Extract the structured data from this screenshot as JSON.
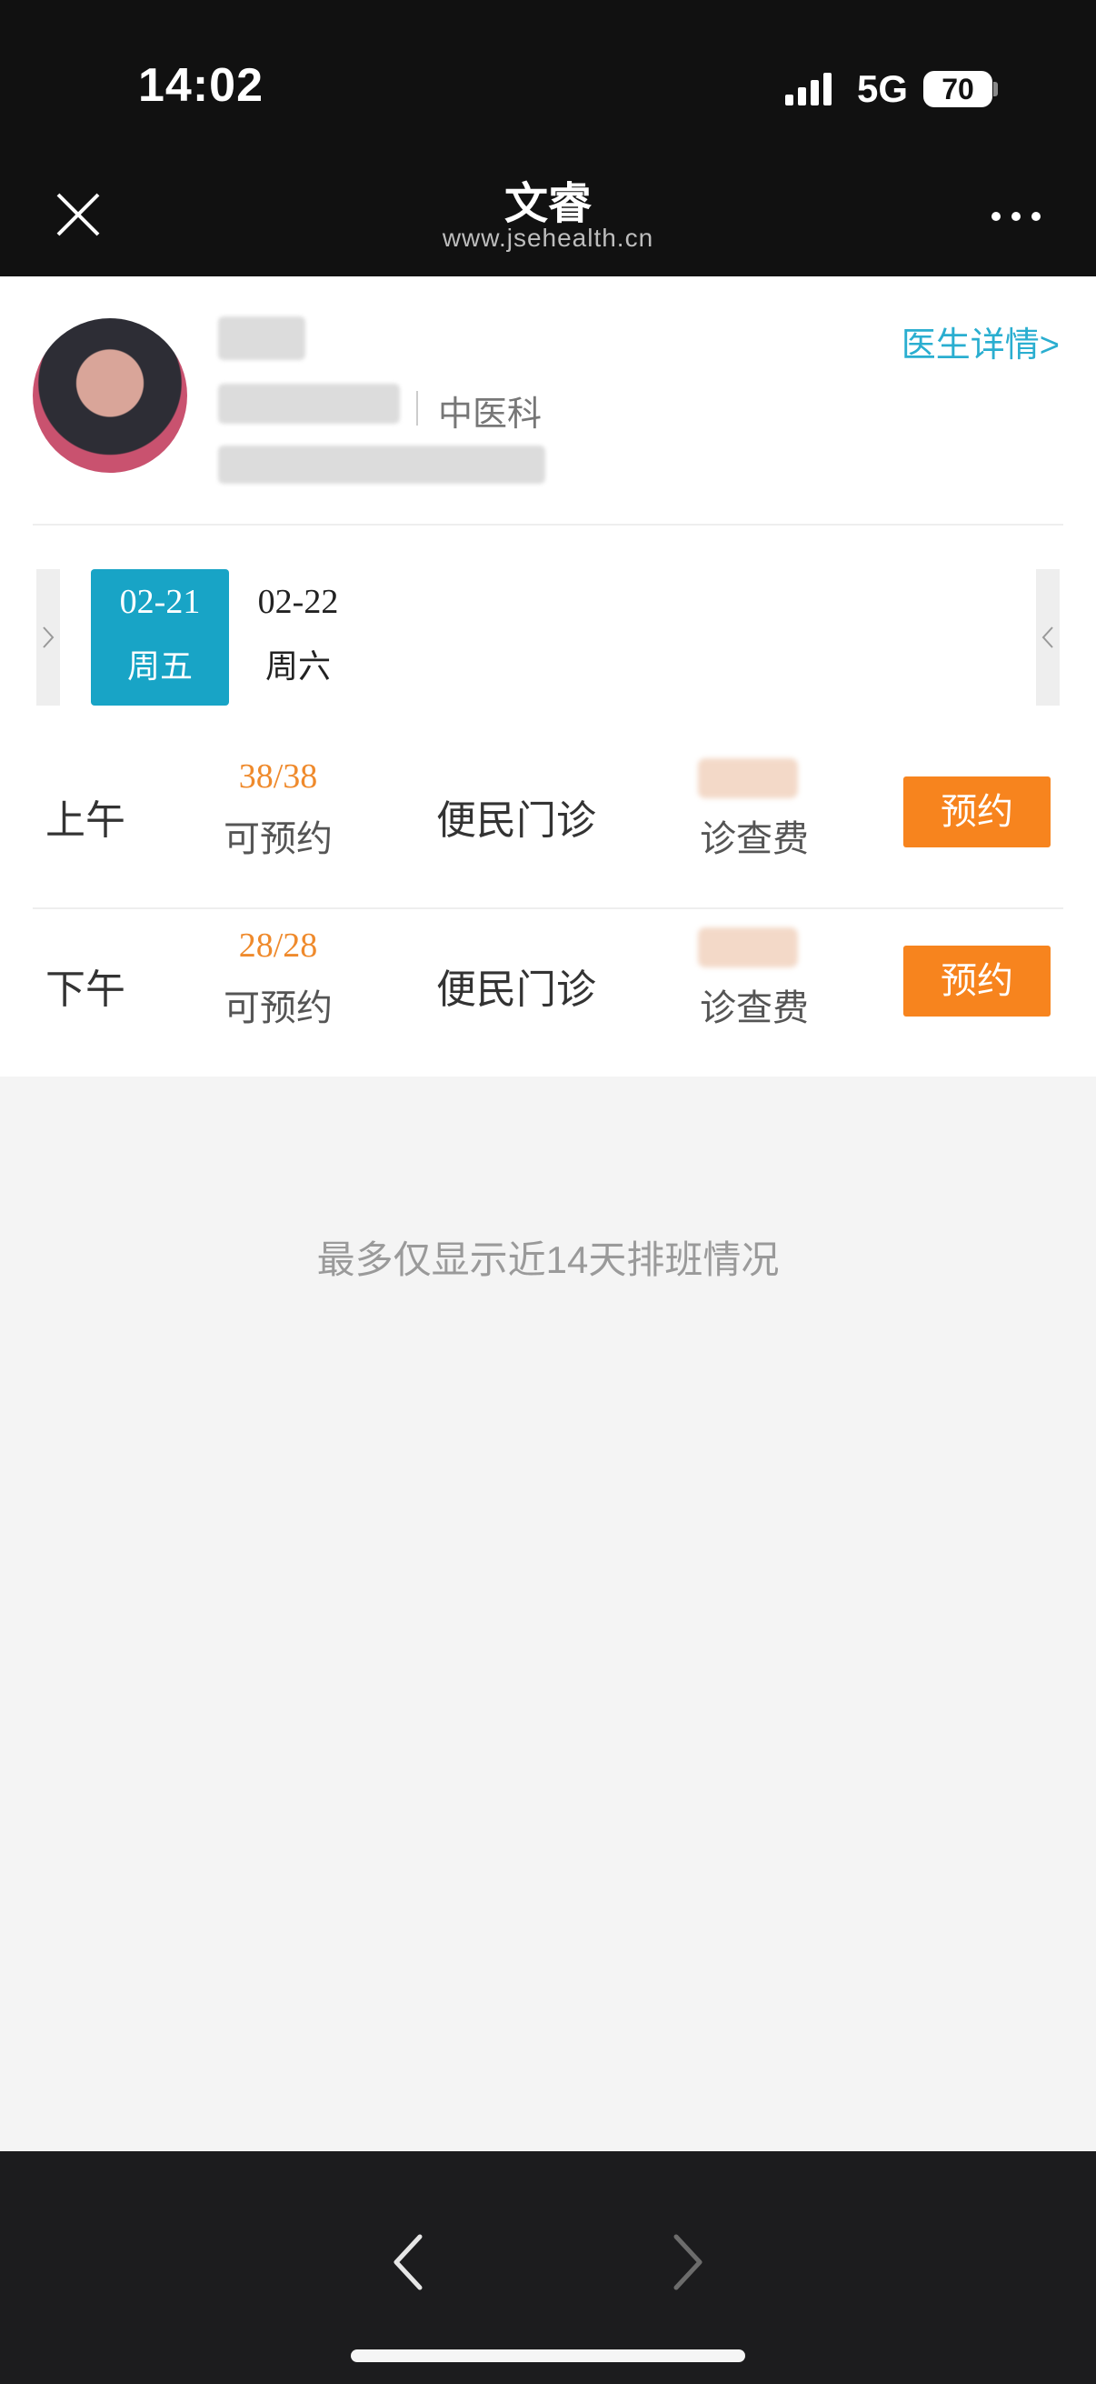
{
  "status_bar": {
    "time": "14:02",
    "network": "5G",
    "battery": "70"
  },
  "nav": {
    "title": "文睿",
    "subtitle": "www.jsehealth.cn"
  },
  "doctor": {
    "department": "中医科",
    "detail_link": "医生详情>"
  },
  "dates": [
    {
      "date": "02-21",
      "weekday": "周五",
      "selected": true
    },
    {
      "date": "02-22",
      "weekday": "周六",
      "selected": false
    }
  ],
  "slots": [
    {
      "period": "上午",
      "count": "38/38",
      "availability": "可预约",
      "type": "便民门诊",
      "fee_label": "诊查费",
      "button": "预约"
    },
    {
      "period": "下午",
      "count": "28/28",
      "availability": "可预约",
      "type": "便民门诊",
      "fee_label": "诊查费",
      "button": "预约"
    }
  ],
  "notice": "最多仅显示近14天排班情况",
  "colors": {
    "accent": "#18a4c6",
    "orange": "#f7841e",
    "link": "#2aaed0"
  },
  "icons": [
    "close-icon",
    "more-icon",
    "chevron-left-icon",
    "chevron-right-icon"
  ]
}
